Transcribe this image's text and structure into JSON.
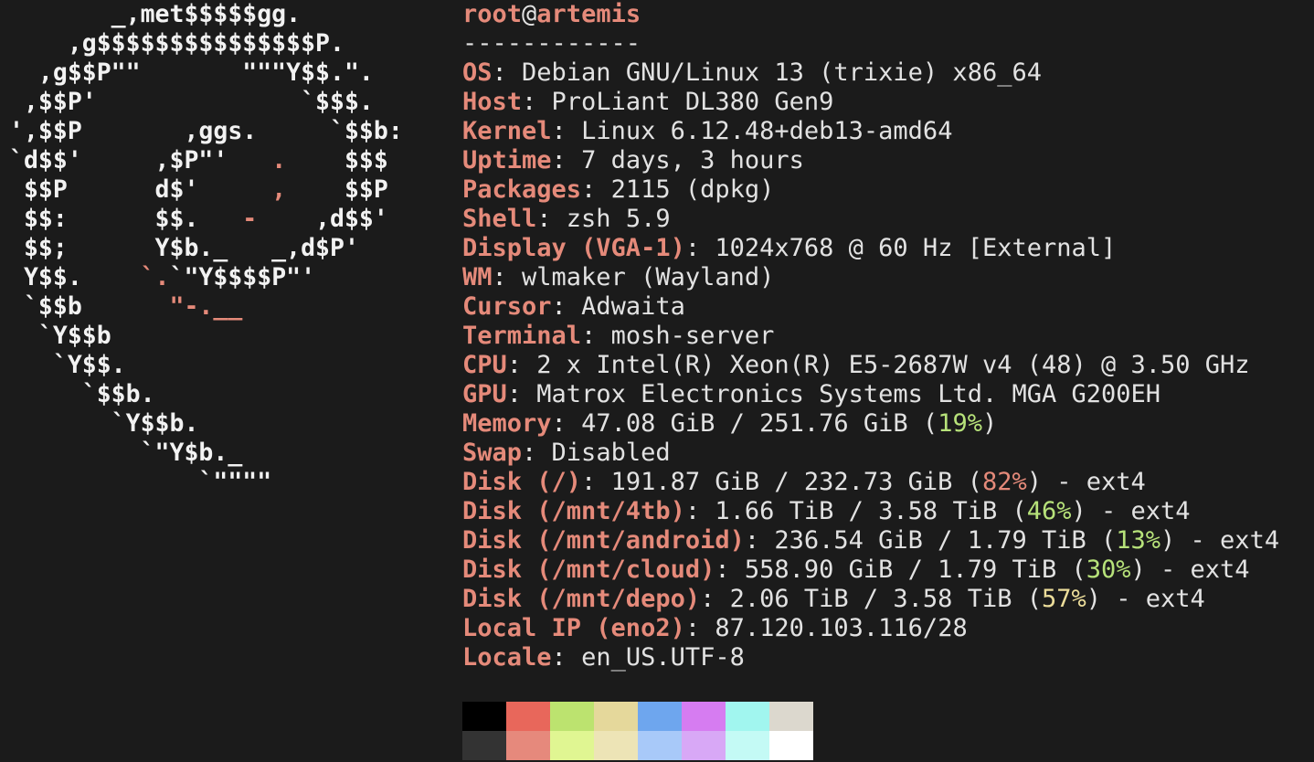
{
  "header": {
    "user": "root",
    "at": "@",
    "host": "artemis",
    "separator": "------------"
  },
  "logo": {
    "l1": "       _,met$$$$$gg.",
    "l2": "    ,g$$$$$$$$$$$$$$$P.",
    "l3": "  ,g$$P\"\"       \"\"\"Y$$.\".",
    "l4": " ,$$P'              `$$$.",
    "l5": "',$$P       ,ggs.     `$$b:",
    "l6a": "`d$$'     ,$P\"'   ",
    "l6b": ".",
    "l6c": "    $$$",
    "l7a": " $$P      d$'     ",
    "l7b": ",",
    "l7c": "    $$P",
    "l8a": " $$:      $$.   ",
    "l8b": "-",
    "l8c": "    ,d$$'",
    "l9": " $$;      Y$b._   _,d$P'",
    "l10a": " Y$$.    ",
    "l10b": "`.",
    "l10c": "`\"Y$$$$P\"'",
    "l11a": " `$$b      ",
    "l11b": "\"-.__",
    "l12": "  `Y$$b",
    "l13": "   `Y$$.",
    "l14": "     `$$b.",
    "l15": "       `Y$$b.",
    "l16": "         `\"Y$b._",
    "l17": "             `\"\"\"\""
  },
  "info": {
    "os": {
      "key": "OS",
      "sep": ": ",
      "value": "Debian GNU/Linux 13 (trixie) x86_64"
    },
    "host": {
      "key": "Host",
      "sep": ": ",
      "value": "ProLiant DL380 Gen9"
    },
    "kernel": {
      "key": "Kernel",
      "sep": ": ",
      "value": "Linux 6.12.48+deb13-amd64"
    },
    "uptime": {
      "key": "Uptime",
      "sep": ": ",
      "value": "7 days, 3 hours"
    },
    "packages": {
      "key": "Packages",
      "sep": ": ",
      "value": "2115 (dpkg)"
    },
    "shell": {
      "key": "Shell",
      "sep": ": ",
      "value": "zsh 5.9"
    },
    "display": {
      "key": "Display (VGA-1)",
      "sep": ": ",
      "value": "1024x768 @ 60 Hz [External]"
    },
    "wm": {
      "key": "WM",
      "sep": ": ",
      "value": "wlmaker (Wayland)"
    },
    "cursor": {
      "key": "Cursor",
      "sep": ": ",
      "value": "Adwaita"
    },
    "terminal": {
      "key": "Terminal",
      "sep": ": ",
      "value": "mosh-server"
    },
    "cpu": {
      "key": "CPU",
      "sep": ": ",
      "value": "2 x Intel(R) Xeon(R) E5-2687W v4 (48) @ 3.50 GHz"
    },
    "gpu": {
      "key": "GPU",
      "sep": ": ",
      "value": "Matrox Electronics Systems Ltd. MGA G200EH"
    },
    "memory": {
      "key": "Memory",
      "sep": ": ",
      "value": "47.08 GiB / 251.76 GiB (",
      "pct": "19%",
      "tail": ")"
    },
    "swap": {
      "key": "Swap",
      "sep": ": ",
      "value": "Disabled"
    },
    "disk_root": {
      "key": "Disk (/)",
      "sep": ": ",
      "value": "191.87 GiB / 232.73 GiB (",
      "pct": "82%",
      "tail": ") - ext4"
    },
    "disk_4tb": {
      "key": "Disk (/mnt/4tb)",
      "sep": ": ",
      "value": "1.66 TiB / 3.58 TiB (",
      "pct": "46%",
      "tail": ") - ext4"
    },
    "disk_android": {
      "key": "Disk (/mnt/android)",
      "sep": ": ",
      "value": "236.54 GiB / 1.79 TiB (",
      "pct": "13%",
      "tail": ") - ext4"
    },
    "disk_cloud": {
      "key": "Disk (/mnt/cloud)",
      "sep": ": ",
      "value": "558.90 GiB / 1.79 TiB (",
      "pct": "30%",
      "tail": ") - ext4"
    },
    "disk_depo": {
      "key": "Disk (/mnt/depo)",
      "sep": ": ",
      "value": "2.06 TiB / 3.58 TiB (",
      "pct": "57%",
      "tail": ") - ext4"
    },
    "local_ip": {
      "key": "Local IP (eno2)",
      "sep": ": ",
      "value": "87.120.103.116/28"
    },
    "locale": {
      "key": "Locale",
      "sep": ": ",
      "value": "en_US.UTF-8"
    }
  },
  "colors": {
    "accent": "#e58a7a",
    "ok": "#b7e27a",
    "warn": "#ecdd9a",
    "background": "#1b1b1b"
  },
  "palette": {
    "normal": [
      "#000000",
      "#e8675b",
      "#bce36f",
      "#e5d89b",
      "#6ea6ee",
      "#d67cf1",
      "#a1f6ef",
      "#dcd8ce"
    ],
    "bright": [
      "#333333",
      "#e6897c",
      "#e0f692",
      "#ede4b6",
      "#a8c9f9",
      "#d8a8f6",
      "#c4faf5",
      "#ffffff"
    ]
  }
}
